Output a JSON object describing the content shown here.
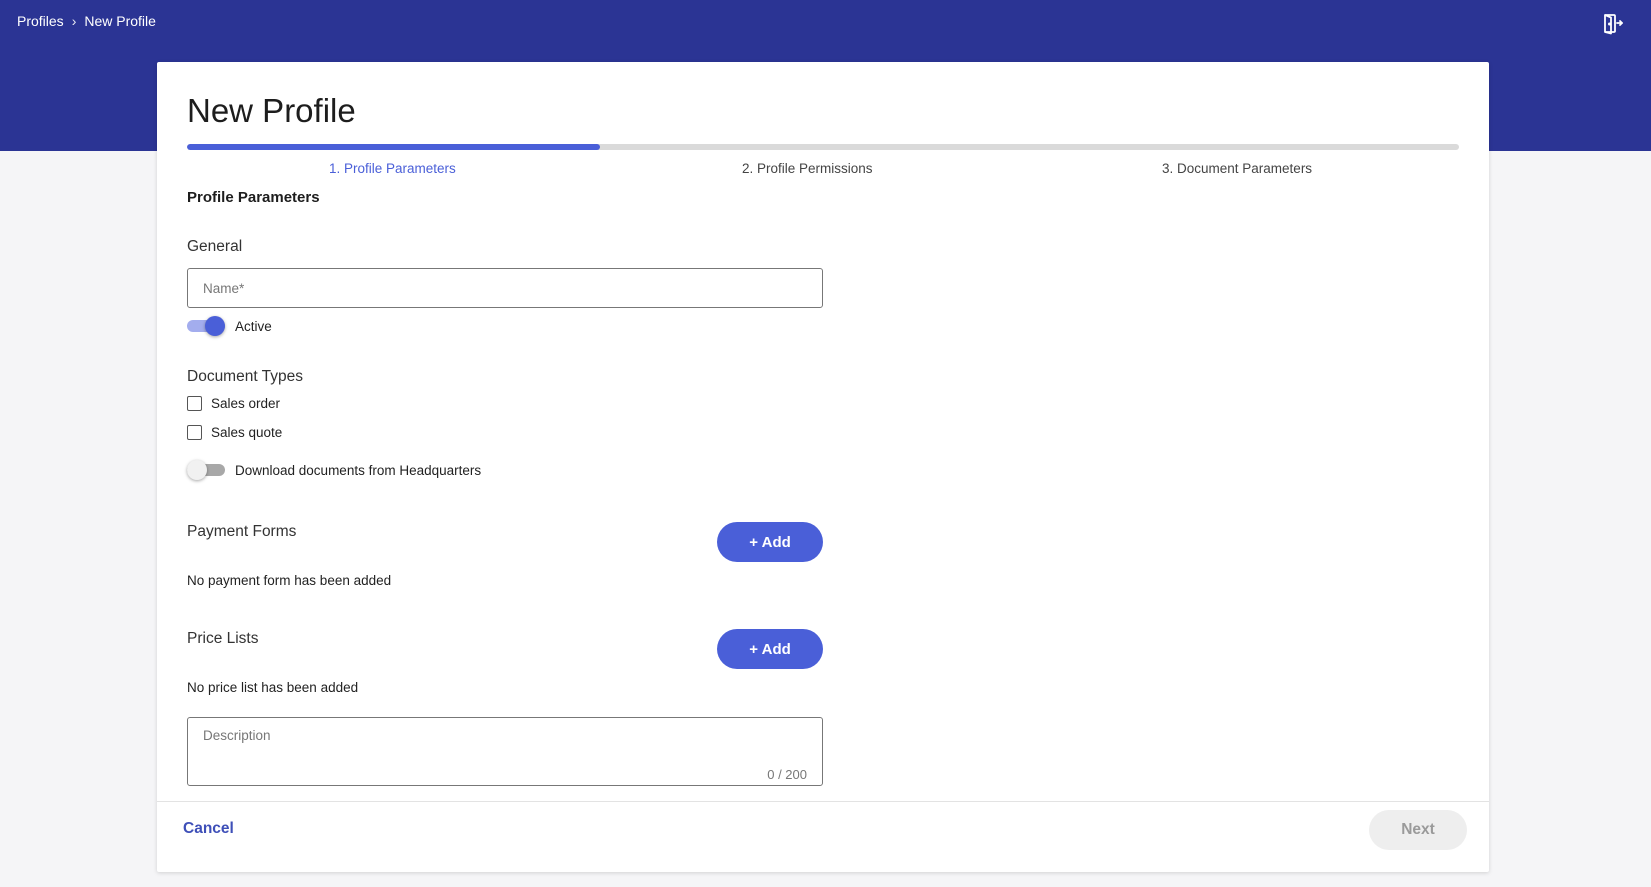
{
  "breadcrumb": {
    "items": [
      "Profiles",
      "New Profile"
    ],
    "separator": "›"
  },
  "header": {
    "exit_icon": "exit-door-icon",
    "bar_color": "#2b3494"
  },
  "page": {
    "title": "New Profile"
  },
  "stepper": {
    "progress_fraction": 0.325,
    "steps": [
      {
        "label": "1. Profile Parameters",
        "active": true
      },
      {
        "label": "2. Profile Permissions",
        "active": false
      },
      {
        "label": "3. Document Parameters",
        "active": false
      }
    ],
    "accent_color": "#4a5fd8"
  },
  "form": {
    "section_title": "Profile Parameters",
    "general": {
      "label": "General",
      "name_placeholder": "Name*",
      "name_value": "",
      "active_label": "Active",
      "active_on": true
    },
    "document_types": {
      "label": "Document Types",
      "options": [
        {
          "label": "Sales order",
          "checked": false
        },
        {
          "label": "Sales quote",
          "checked": false
        }
      ],
      "download_label": "Download documents from Headquarters",
      "download_on": false
    },
    "payment_forms": {
      "label": "Payment Forms",
      "add_label": "+ Add",
      "empty_message": "No payment form has been added"
    },
    "price_lists": {
      "label": "Price Lists",
      "add_label": "+ Add",
      "empty_message": "No price list has been added"
    },
    "description": {
      "placeholder": "Description",
      "value": "",
      "counter": "0 / 200"
    }
  },
  "footer": {
    "cancel_label": "Cancel",
    "next_label": "Next"
  }
}
